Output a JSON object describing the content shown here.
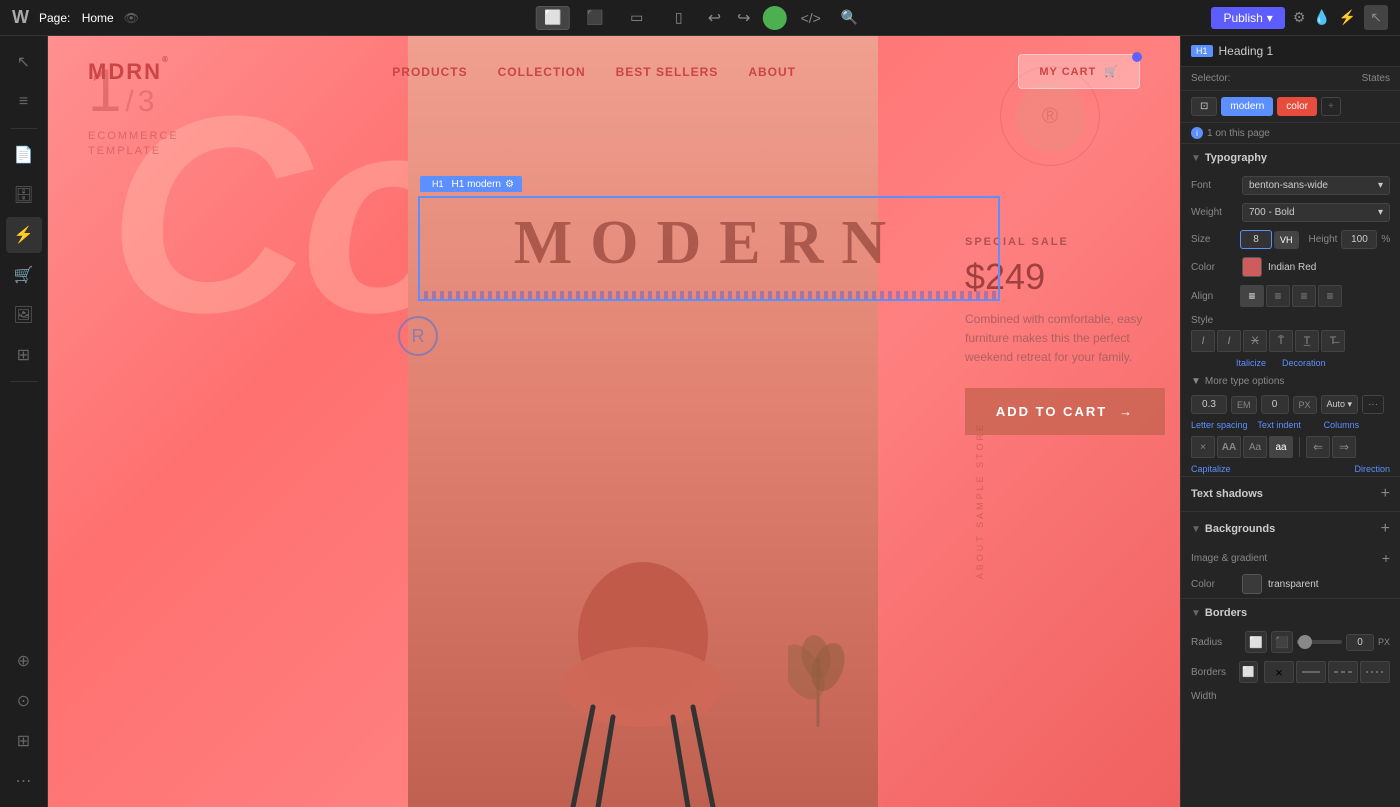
{
  "topbar": {
    "page_label": "Page:",
    "page_name": "Home",
    "publish_label": "Publish",
    "devices": [
      {
        "id": "desktop",
        "icon": "⬜",
        "active": true
      },
      {
        "id": "tablet-lg",
        "icon": "⬛",
        "active": false
      },
      {
        "id": "laptop",
        "icon": "▭",
        "active": false
      },
      {
        "id": "mobile",
        "icon": "▯",
        "active": false
      }
    ]
  },
  "panel": {
    "heading_badge": "H1",
    "heading_label": "Heading 1",
    "selector_label": "Selector:",
    "states_label": "States",
    "chips": [
      {
        "id": "screen",
        "label": "⊡"
      },
      {
        "id": "modern",
        "label": "modern"
      },
      {
        "id": "color",
        "label": "color"
      }
    ],
    "on_page": "1 on this page",
    "typography_label": "Typography",
    "font_label": "Font",
    "font_value": "benton-sans-wide",
    "weight_label": "Weight",
    "weight_value": "700 - Bold",
    "size_label": "Size",
    "size_value": "8",
    "size_unit": "VH",
    "height_label": "Height",
    "height_value": "100",
    "height_unit": "%",
    "color_label": "Color",
    "color_name": "Indian Red",
    "color_hex": "#cd5c5c",
    "align_label": "Align",
    "style_label": "Style",
    "italicize_label": "Italicize",
    "decoration_label": "Decoration",
    "more_type_label": "More type options",
    "letter_spacing_value": "0.3",
    "letter_spacing_unit": "EM",
    "text_indent_value": "0",
    "text_indent_unit": "PX",
    "columns_value": "Auto",
    "letter_spacing_label": "Letter spacing",
    "text_indent_label": "Text indent",
    "columns_label": "Columns",
    "capitalize_label": "Capitalize",
    "direction_label": "Direction",
    "text_shadows_label": "Text shadows",
    "backgrounds_label": "Backgrounds",
    "image_gradient_label": "Image & gradient",
    "bg_color_label": "Color",
    "bg_color_name": "transparent",
    "bg_color_swatch": "#3a3a3a",
    "borders_label": "Borders",
    "radius_label": "Radius",
    "radius_value": "0",
    "radius_unit": "PX",
    "borders_style_label": "Borders",
    "width_label": "Width"
  },
  "preview": {
    "logo": "MDRN",
    "logo_sup": "®",
    "nav_links": [
      "PRODUCTS",
      "COLLECTION",
      "BEST SELLERS",
      "ABOUT"
    ],
    "cart_label": "MY CART",
    "counter_current": "1",
    "counter_separator": "/",
    "counter_total": "3",
    "subtitle_line1": "ECOMMERCE",
    "subtitle_line2": "TEMPLATE",
    "cozy_text": "Cozy",
    "modern_heading": "MODERN",
    "circle_mark": "®",
    "sale_tag": "SPECIAL SALE",
    "price": "$249",
    "description": "Combined with comfortable, easy furniture makes this the perfect weekend retreat for your family.",
    "add_to_cart": "ADD TO CART",
    "arrow": "→",
    "vertical_text": "ABOUT SAMPLE STORE",
    "selected_badge": "H1 modern",
    "selector_element_label": "H1",
    "selector_state_label": "modern"
  }
}
